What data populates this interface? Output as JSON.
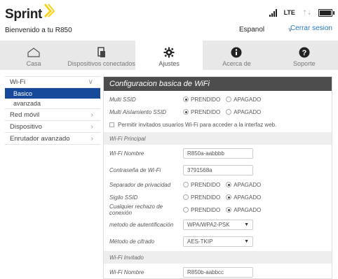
{
  "header": {
    "brand": "Sprint",
    "welcome": "Bienvenido a tu R850",
    "lte_label": "LTE",
    "arrows": "⇡⇣",
    "language": "Espanol",
    "logout": "Cerrar sesion"
  },
  "nav": {
    "tabs": [
      {
        "label": "Casa",
        "icon": "home-icon"
      },
      {
        "label": "Dispositivos conectados",
        "icon": "connected-devices-icon"
      },
      {
        "label": "Ajustes",
        "icon": "gear-icon"
      },
      {
        "label": "Acerca de",
        "icon": "info-icon"
      },
      {
        "label": "Soporte",
        "icon": "help-icon"
      }
    ]
  },
  "sidebar": {
    "items": [
      {
        "label": "Wi-Fi"
      },
      {
        "label": "Basico"
      },
      {
        "label": "avanzada"
      },
      {
        "label": "Red móvil"
      },
      {
        "label": "Dispositivo"
      },
      {
        "label": "Enrutador avanzado"
      }
    ]
  },
  "panel": {
    "title": "Configuracion basica de WiFi",
    "on": "PRENDIDO",
    "off": "APAGADO",
    "multi_ssid": "Multi SSID",
    "multi_isolation": "Multi Aislamiento SSID",
    "guest_access": "Permitir invitados usuarios Wi-Fi para acceder a la interfaz web.",
    "section_main": "Wi-Fi Principal",
    "wifi_name_label": "Wi-Fi Nombre",
    "wifi_name_value": "R850a-aabbbb",
    "password_label": "Contraseña de Wi-Fi",
    "password_value": "3791568a",
    "privacy_sep": "Separador de privacidad",
    "ssid_stealth": "Sigilo SSID",
    "reject_any": "Cualquier rechazo de conexión",
    "auth_label": "metodo de autentificación",
    "auth_value": "WPA/WPA2-PSK",
    "cipher_label": "Método de cifrado",
    "cipher_value": "AES-TKIP",
    "section_guest": "Wi-Fi Invitado",
    "guest_name_label": "Wi-Fi Nombre",
    "guest_name_value": "R850b-aabbcc"
  }
}
